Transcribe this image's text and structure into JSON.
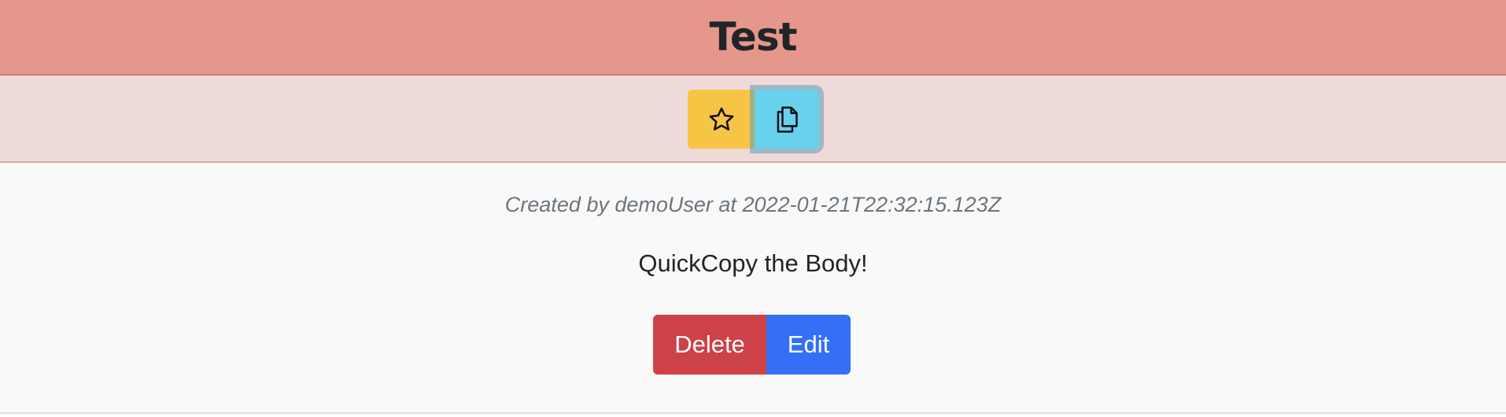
{
  "card": {
    "title": "Test",
    "toolbar": {
      "favorite_icon": "star-icon",
      "copy_icon": "copy-icon",
      "colors": {
        "favorite_button": "#f7c544",
        "copy_button": "#67d1ee"
      }
    },
    "meta": "Created by demoUser at 2022-01-21T22:32:15.123Z",
    "body": "QuickCopy the Body!",
    "actions": {
      "delete_label": "Delete",
      "edit_label": "Edit",
      "colors": {
        "delete": "#cd4148",
        "edit": "#3370f5"
      }
    },
    "colors": {
      "header": "#e5978c",
      "toolbar": "#eddad9"
    }
  }
}
